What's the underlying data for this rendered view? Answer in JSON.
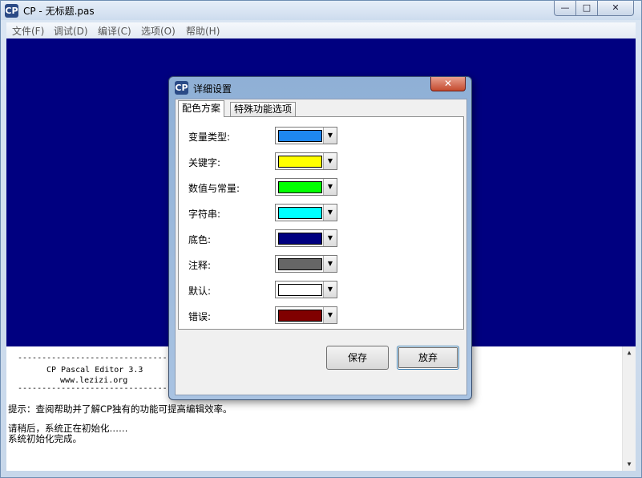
{
  "window": {
    "title": "CP - 无标题.pas",
    "icon_text": "CP",
    "min_glyph": "—",
    "max_glyph": "□",
    "close_glyph": "✕"
  },
  "menu": [
    "文件(F)",
    "调试(D)",
    "编译(C)",
    "选项(O)",
    "帮助(H)"
  ],
  "console": {
    "banner_line": "--------------------------------------",
    "banner_title": "CP Pascal Editor 3.3",
    "banner_url": "www.lezizi.org",
    "hint": "提示：查阅帮助并了解CP独有的功能可提高编辑效率。",
    "init_line": "请稍后，系统正在初始化……",
    "done_line": "系统初始化完成。",
    "scroll_up": "▲",
    "scroll_down": "▼"
  },
  "dialog": {
    "title": "详细设置",
    "icon_text": "CP",
    "close_glyph": "✕",
    "tabs": [
      "配色方案",
      "特殊功能选项"
    ],
    "rows": [
      {
        "label": "变量类型:",
        "color": "#1e87f0"
      },
      {
        "label": "关键字:",
        "color": "#ffff00"
      },
      {
        "label": "数值与常量:",
        "color": "#00ff00"
      },
      {
        "label": "字符串:",
        "color": "#00ffff"
      },
      {
        "label": "底色:",
        "color": "#000080"
      },
      {
        "label": "注释:",
        "color": "#666666"
      },
      {
        "label": "默认:",
        "color": "#ffffff"
      },
      {
        "label": "错误:",
        "color": "#800000"
      }
    ],
    "dropdown_glyph": "▼",
    "save_label": "保存",
    "cancel_label": "放弃"
  }
}
